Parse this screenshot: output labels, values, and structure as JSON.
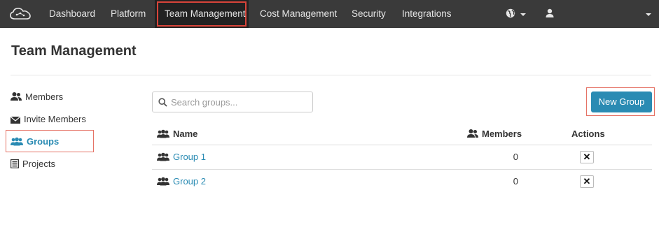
{
  "navbar": {
    "items": [
      {
        "label": "Dashboard"
      },
      {
        "label": "Platform"
      },
      {
        "label": "Team Management"
      },
      {
        "label": "Cost Management"
      },
      {
        "label": "Security"
      },
      {
        "label": "Integrations"
      }
    ],
    "active": "Team Management"
  },
  "page": {
    "title": "Team Management"
  },
  "sidebar": {
    "items": [
      {
        "label": "Members",
        "icon": "members-icon"
      },
      {
        "label": "Invite Members",
        "icon": "envelope-icon"
      },
      {
        "label": "Groups",
        "icon": "groups-icon"
      },
      {
        "label": "Projects",
        "icon": "projects-icon"
      }
    ],
    "active": "Groups"
  },
  "search": {
    "placeholder": "Search groups...",
    "value": ""
  },
  "new_group_button": {
    "label": "New Group"
  },
  "table": {
    "columns": {
      "name": "Name",
      "members": "Members",
      "actions": "Actions"
    },
    "rows": [
      {
        "name": "Group 1",
        "members": "0",
        "action": "✕"
      },
      {
        "name": "Group 2",
        "members": "0",
        "action": "✕"
      }
    ]
  },
  "colors": {
    "navbar_bg": "#3a3a3a",
    "accent": "#2a8bb3",
    "highlight": "#d9443a"
  }
}
